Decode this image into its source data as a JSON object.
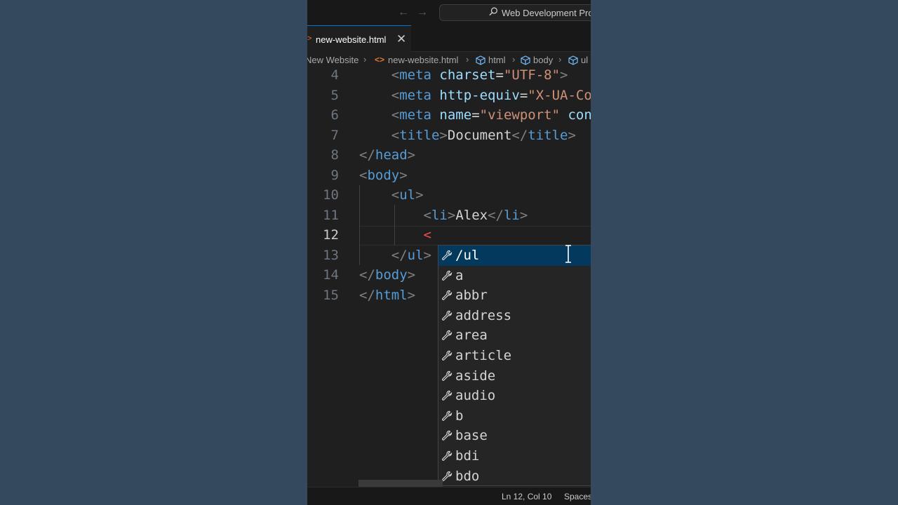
{
  "window": {
    "command_center": "Web Development Pro"
  },
  "tab": {
    "label": "new-website.html"
  },
  "breadcrumb": [
    "New Website",
    "new-website.html",
    "html",
    "body",
    "ul"
  ],
  "code_lines": [
    {
      "n": "4",
      "tokens": [
        [
          "    ",
          "txt"
        ],
        [
          "<",
          "tag-b"
        ],
        [
          "meta",
          "tag-n"
        ],
        [
          " charset",
          "attr"
        ],
        [
          "=",
          "txt"
        ],
        [
          "\"UTF-8\"",
          "str"
        ],
        [
          ">",
          "tag-b"
        ]
      ]
    },
    {
      "n": "5",
      "tokens": [
        [
          "    ",
          "txt"
        ],
        [
          "<",
          "tag-b"
        ],
        [
          "meta",
          "tag-n"
        ],
        [
          " http-equiv",
          "attr"
        ],
        [
          "=",
          "txt"
        ],
        [
          "\"X-UA-Compatible\"",
          "str"
        ]
      ]
    },
    {
      "n": "6",
      "tokens": [
        [
          "    ",
          "txt"
        ],
        [
          "<",
          "tag-b"
        ],
        [
          "meta",
          "tag-n"
        ],
        [
          " name",
          "attr"
        ],
        [
          "=",
          "txt"
        ],
        [
          "\"viewport\"",
          "str"
        ],
        [
          " content",
          "attr"
        ]
      ]
    },
    {
      "n": "7",
      "tokens": [
        [
          "    ",
          "txt"
        ],
        [
          "<",
          "tag-b"
        ],
        [
          "title",
          "tag-n"
        ],
        [
          ">",
          "tag-b"
        ],
        [
          "Document",
          "txt"
        ],
        [
          "</",
          "tag-b"
        ],
        [
          "title",
          "tag-n"
        ],
        [
          ">",
          "tag-b"
        ]
      ]
    },
    {
      "n": "8",
      "tokens": [
        [
          "</",
          "tag-b"
        ],
        [
          "head",
          "tag-n"
        ],
        [
          ">",
          "tag-b"
        ]
      ]
    },
    {
      "n": "9",
      "tokens": [
        [
          "<",
          "tag-b"
        ],
        [
          "body",
          "tag-n"
        ],
        [
          ">",
          "tag-b"
        ]
      ]
    },
    {
      "n": "10",
      "tokens": [
        [
          "    ",
          "txt"
        ],
        [
          "<",
          "tag-b"
        ],
        [
          "ul",
          "tag-n"
        ],
        [
          ">",
          "tag-b"
        ]
      ]
    },
    {
      "n": "11",
      "tokens": [
        [
          "        ",
          "txt"
        ],
        [
          "<",
          "tag-b"
        ],
        [
          "li",
          "tag-n"
        ],
        [
          ">",
          "tag-b"
        ],
        [
          "Alex",
          "txt"
        ],
        [
          "</",
          "tag-b"
        ],
        [
          "li",
          "tag-n"
        ],
        [
          ">",
          "tag-b"
        ]
      ]
    },
    {
      "n": "12",
      "active": true,
      "tokens": [
        [
          "        ",
          "txt"
        ],
        [
          "<",
          "err"
        ]
      ]
    },
    {
      "n": "13",
      "tokens": [
        [
          "    ",
          "txt"
        ],
        [
          "</",
          "tag-b"
        ],
        [
          "ul",
          "tag-n"
        ],
        [
          ">",
          "tag-b"
        ]
      ]
    },
    {
      "n": "14",
      "tokens": [
        [
          "</",
          "tag-b"
        ],
        [
          "body",
          "tag-n"
        ],
        [
          ">",
          "tag-b"
        ]
      ]
    },
    {
      "n": "15",
      "tokens": [
        [
          "</",
          "tag-b"
        ],
        [
          "html",
          "tag-n"
        ],
        [
          ">",
          "tag-b"
        ]
      ]
    }
  ],
  "suggestions": [
    "/ul",
    "a",
    "abbr",
    "address",
    "area",
    "article",
    "aside",
    "audio",
    "b",
    "base",
    "bdi",
    "bdo"
  ],
  "suggestion_icon": "wrench-icon",
  "status": {
    "position": "Ln 12, Col 10",
    "indentation": "Spaces"
  },
  "colors": {
    "background": "#35495e",
    "editor": "#1f1f1f",
    "tag": "#569cd6",
    "attribute": "#9cdcfe",
    "string": "#ce9178",
    "selected_suggestion": "#04395e"
  }
}
